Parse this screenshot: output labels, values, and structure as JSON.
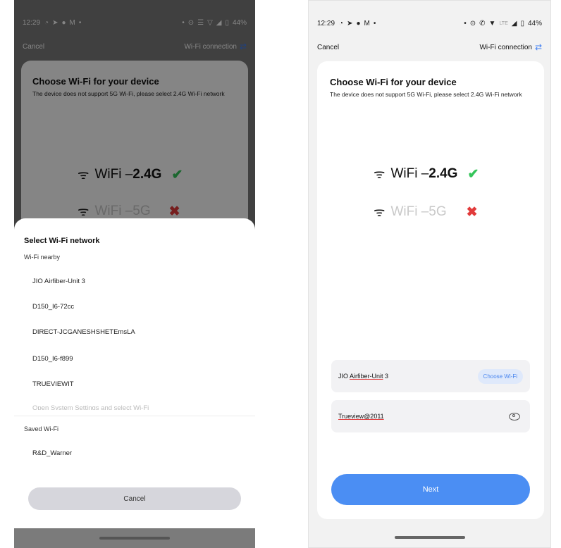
{
  "status_bar": {
    "time": "12:29",
    "battery": "44%",
    "network": "LTE"
  },
  "header": {
    "cancel": "Cancel",
    "connection": "Wi-Fi connection"
  },
  "choose": {
    "title": "Choose Wi-Fi for your device",
    "description": "The device does not support 5G Wi-Fi, please select 2.4G Wi-Fi network",
    "band_24": {
      "label": "WiFi – ",
      "value": "2.4G",
      "mark": "✔"
    },
    "band_5": {
      "label": "WiFi – ",
      "value": "5G",
      "mark": "✖"
    }
  },
  "sheet": {
    "title": "Select Wi-Fi network",
    "nearby_label": "Wi-Fi nearby",
    "networks": [
      "JIO Airfiber-Unit 3",
      "D150_I6-72cc",
      "DIRECT-JCGANESHSHETEmsLA",
      "D150_I6-f899",
      "TRUEVIEWIT"
    ],
    "system_settings": "Open System Settings and select Wi-Fi",
    "saved_label": "Saved Wi-Fi",
    "saved": [
      "R&D_Warner"
    ],
    "cancel": "Cancel"
  },
  "form": {
    "ssid": "JIO Airfiber-Unit 3",
    "ssid_prefix": "JIO ",
    "ssid_marked": "Airfiber-Unit",
    "ssid_suffix": " 3",
    "choose_button": "Choose Wi-Fi",
    "password": "Trueview@2011",
    "next": "Next"
  },
  "colors": {
    "accent": "#4b8ef3",
    "check": "#35c55a",
    "cross": "#e23b3b"
  }
}
